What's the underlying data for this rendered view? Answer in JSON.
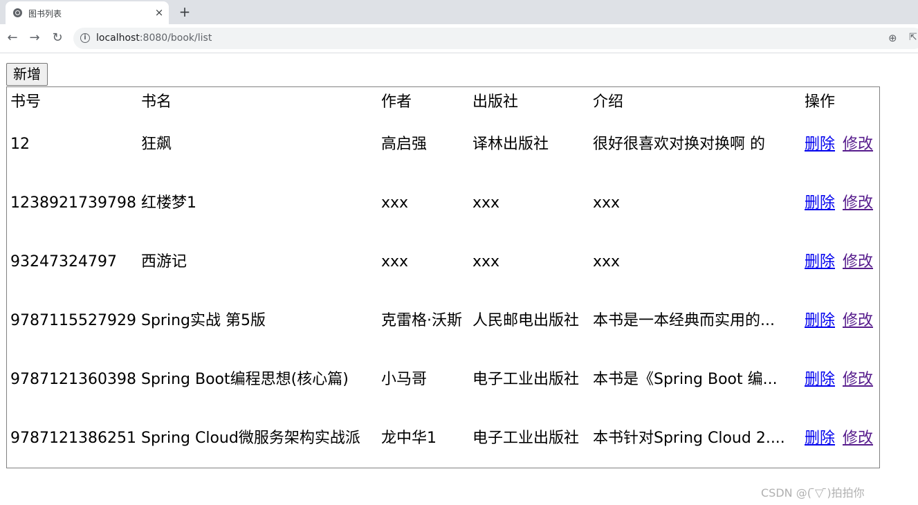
{
  "browser": {
    "tab_title": "图书列表",
    "tab_close": "×",
    "new_tab": "+",
    "url_host": "localhost",
    "url_port_path": ":8080/book/list"
  },
  "page": {
    "add_button": "新增",
    "headers": [
      "书号",
      "书名",
      "作者",
      "出版社",
      "介绍",
      "操作"
    ],
    "rows": [
      {
        "isbn": "12",
        "name": "狂飙",
        "author": "高启强",
        "publisher": "译林出版社",
        "intro": "很好很喜欢对换对换啊 的",
        "delete": "删除",
        "edit": "修改"
      },
      {
        "isbn": "1238921739798",
        "name": "红楼梦1",
        "author": "xxx",
        "publisher": "xxx",
        "intro": "xxx",
        "delete": "删除",
        "edit": "修改"
      },
      {
        "isbn": "93247324797",
        "name": "西游记",
        "author": "xxx",
        "publisher": "xxx",
        "intro": "xxx",
        "delete": "删除",
        "edit": "修改"
      },
      {
        "isbn": "9787115527929",
        "name": "Spring实战 第5版",
        "author": "克雷格·沃斯",
        "publisher": "人民邮电出版社",
        "intro": "本书是一本经典而实用的...",
        "delete": "删除",
        "edit": "修改"
      },
      {
        "isbn": "9787121360398",
        "name": "Spring Boot编程思想(核心篇)",
        "author": "小马哥",
        "publisher": "电子工业出版社",
        "intro": "本书是《Spring Boot 编...",
        "delete": "删除",
        "edit": "修改"
      },
      {
        "isbn": "9787121386251",
        "name": "Spring Cloud微服务架构实战派",
        "author": "龙中华1",
        "publisher": "电子工业出版社",
        "intro": "本书针对Spring Cloud 2....",
        "delete": "删除",
        "edit": "修改"
      }
    ]
  },
  "watermark": "CSDN @( ̄▽ ̄)拍拍你"
}
